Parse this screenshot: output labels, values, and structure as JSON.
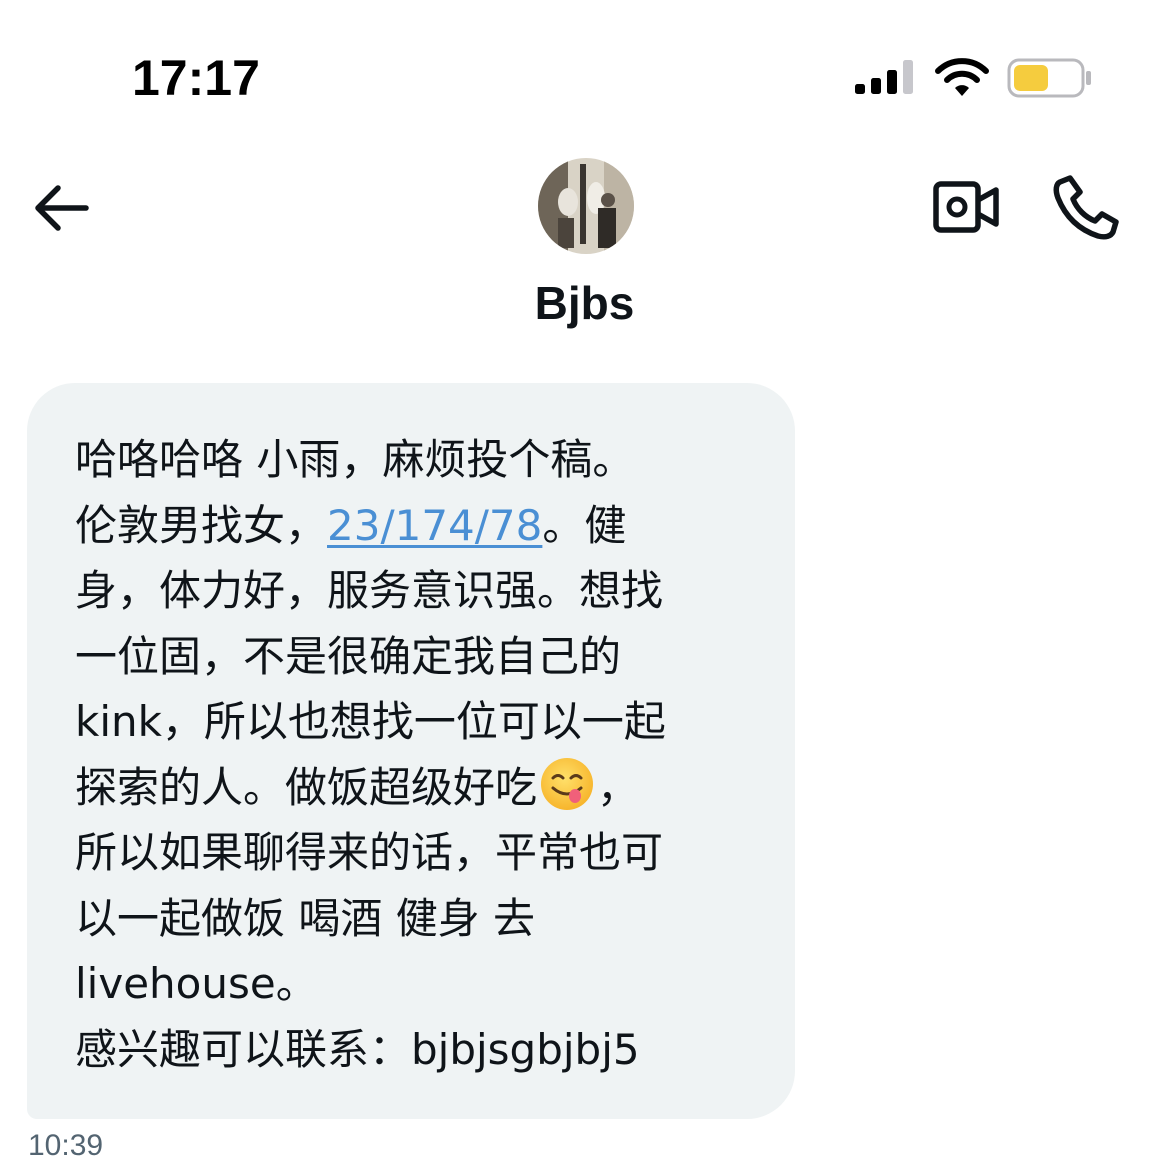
{
  "status_bar": {
    "time": "17:17",
    "battery_color": "#f5cc3e"
  },
  "header": {
    "contact_name": "Bjbs",
    "back_icon": "arrow-left-icon",
    "video_icon": "video-camera-icon",
    "phone_icon": "phone-icon"
  },
  "message": {
    "lines": [
      "哈咯哈咯 小雨，麻烦投个稿。",
      "伦敦男找女，",
      "23/174/78",
      "。健",
      "身，体力好，服务意识强。想找",
      "一位固，不是很确定我自己的",
      "kink，所以也想找一位可以一起",
      "探索的人。做饭超级好吃",
      "，",
      "所以如果聊得来的话，平常也可",
      "以一起做饭 喝酒 健身 去",
      "livehouse。",
      "感兴趣可以联系：bjbjsgbjbj5"
    ],
    "emoji_name": "face-savoring-food-emoji",
    "link_color": "#4a8fd4",
    "bubble_color": "#eff3f4",
    "timestamp": "10:39"
  }
}
